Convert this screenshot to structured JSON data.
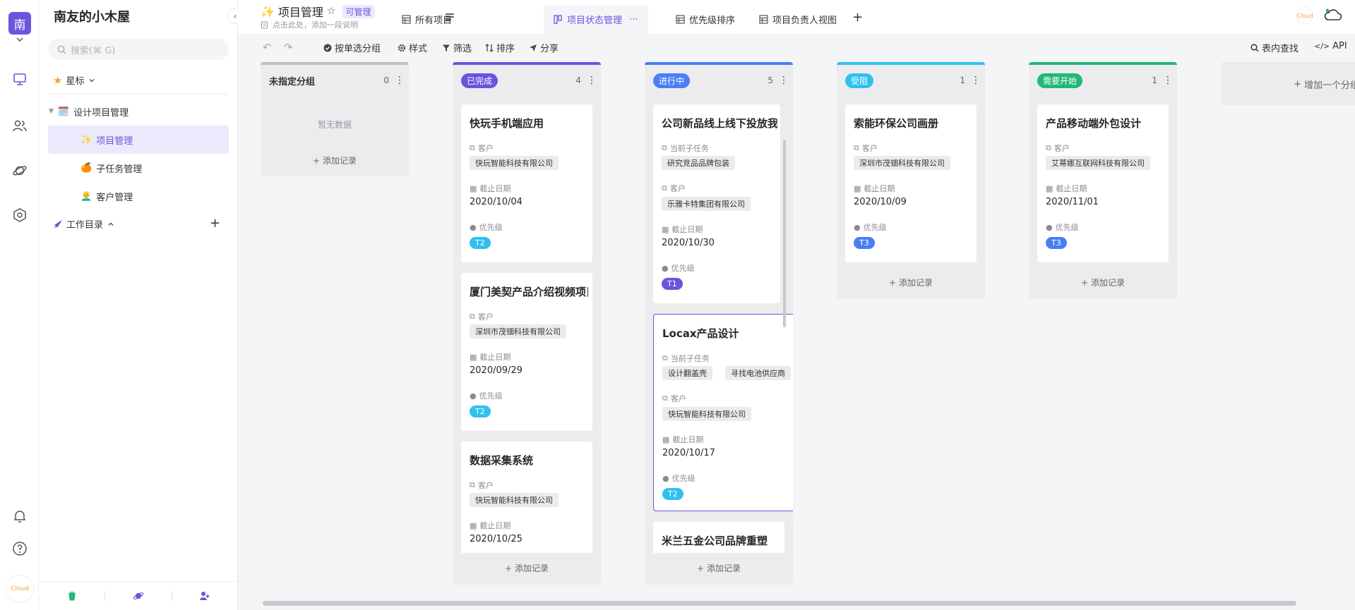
{
  "rail": {
    "avatar_letter": "南",
    "logo_text": "CIoud"
  },
  "sidebar": {
    "space_title": "南友的小木屋",
    "search_placeholder": "搜索(⌘ G)",
    "favorites_label": "星标",
    "tree": {
      "folder": {
        "icon": "🗓️",
        "label": "设计项目管理"
      },
      "items": [
        {
          "icon": "✨",
          "label": "项目管理"
        },
        {
          "icon": "🍊",
          "label": "子任务管理"
        },
        {
          "icon": "👨‍🦲",
          "label": "客户管理"
        }
      ]
    },
    "workdir_label": "工作目录"
  },
  "header": {
    "title_emoji": "✨",
    "title": "项目管理",
    "permission_badge": "可管理",
    "description_placeholder": "点击此处，添加一段说明",
    "tabs": [
      {
        "label": "所有项目"
      },
      {
        "label": "项目状态管理"
      },
      {
        "label": "优先级排序"
      },
      {
        "label": "项目负责人视图"
      }
    ],
    "tab_more": "⋯"
  },
  "toolbar": {
    "group_by": "按单选分组",
    "style": "样式",
    "filter": "筛选",
    "sort": "排序",
    "share": "分享",
    "find": "表内查找",
    "api": "API"
  },
  "board": {
    "add_record": "添加记录",
    "add_group": "增加一个分组",
    "empty_text": "暂无数据",
    "field_customer": "客户",
    "field_deadline": "截止日期",
    "field_priority": "优先级",
    "field_subtask": "当前子任务",
    "priority_colors": {
      "T1": "#6a55dc",
      "T2": "#30c0f0",
      "T3": "#4a7ef5"
    },
    "columns": [
      {
        "name": "未指定分组",
        "count": "0",
        "color": "#c0c0c4"
      },
      {
        "name": "已完成",
        "count": "4",
        "color": "#6a55dc"
      },
      {
        "name": "进行中",
        "count": "5",
        "color": "#4a7ef5"
      },
      {
        "name": "受阻",
        "count": "1",
        "color": "#30c0f0"
      },
      {
        "name": "需要开始",
        "count": "1",
        "color": "#20b875"
      }
    ],
    "cards": {
      "done": [
        {
          "title": "快玩手机端应用",
          "customer": "快玩智能科技有限公司",
          "deadline": "2020/10/04",
          "priority": "T2"
        },
        {
          "title": "厦门美契产品介绍视频项目",
          "customer": "深圳市茂钿科技有限公司",
          "deadline": "2020/09/29",
          "priority": "T2"
        },
        {
          "title": "数据采集系统",
          "customer": "快玩智能科技有限公司",
          "deadline": "2020/10/25"
        }
      ],
      "doing": [
        {
          "title": "公司新品线上线下投放我依",
          "subtasks": [
            "研究竞品品牌包装"
          ],
          "customer": "乐雅卡特集团有限公司",
          "deadline": "2020/10/30",
          "priority": "T1"
        },
        {
          "title": "Locax产品设计",
          "subtasks": [
            "设计翻盖壳",
            "寻找电池供应商"
          ],
          "customer": "快玩智能科技有限公司",
          "deadline": "2020/10/17",
          "priority": "T2"
        },
        {
          "title": "米兰五金公司品牌重塑"
        }
      ],
      "blocked": [
        {
          "title": "索能环保公司画册",
          "customer": "深圳市茂钿科技有限公司",
          "deadline": "2020/10/09",
          "priority": "T3"
        }
      ],
      "todo": [
        {
          "title": "产品移动端外包设计",
          "customer": "艾蒂娜互联网科技有限公司",
          "deadline": "2020/11/01",
          "priority": "T3"
        }
      ]
    }
  }
}
